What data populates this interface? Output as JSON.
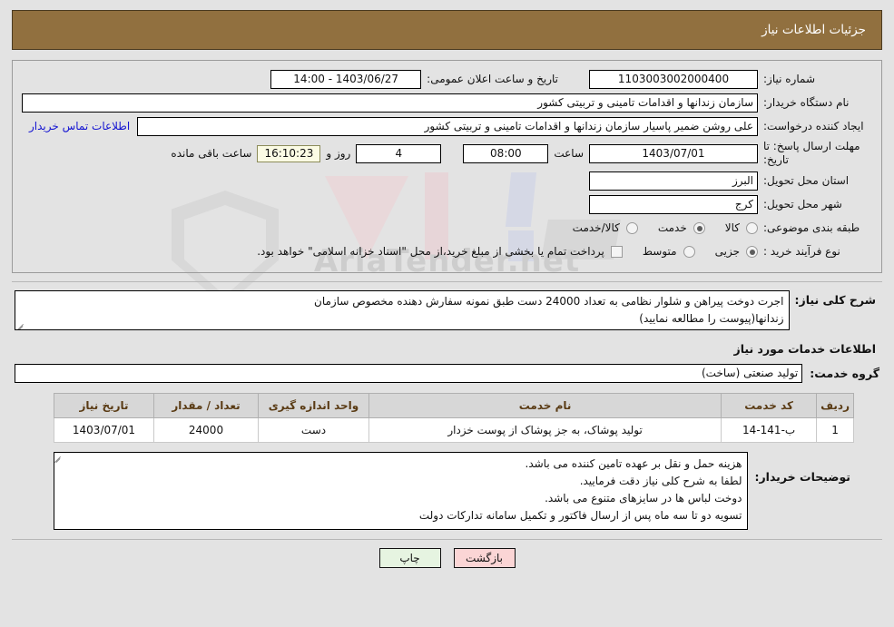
{
  "header": {
    "title": "جزئیات اطلاعات نیاز"
  },
  "form": {
    "need_number_label": "شماره نیاز:",
    "need_number_value": "1103003002000400",
    "public_announce_label": "تاریخ و ساعت اعلان عمومی:",
    "public_announce_value": "1403/06/27 - 14:00",
    "buyer_org_label": "نام دستگاه خریدار:",
    "buyer_org_value": "سازمان زندانها و اقدامات تامینی و تربیتی کشور",
    "requester_label": "ایجاد کننده درخواست:",
    "requester_value": "علی روشن ضمیر پاسیار سازمان زندانها و اقدامات تامینی و تربیتی کشور",
    "contact_link": "اطلاعات تماس خریدار",
    "deadline_label": "مهلت ارسال پاسخ: تا تاریخ:",
    "deadline_date": "1403/07/01",
    "deadline_time_label": "ساعت",
    "deadline_time": "08:00",
    "remaining_days": "4",
    "remaining_days_label": "روز و",
    "remaining_clock": "16:10:23",
    "remaining_suffix_label": "ساعت باقی مانده",
    "province_label": "استان محل تحویل:",
    "province_value": "البرز",
    "city_label": "شهر محل تحویل:",
    "city_value": "کرج",
    "category_label": "طبقه بندی موضوعی:",
    "category_options": [
      {
        "label": "کالا",
        "selected": false
      },
      {
        "label": "خدمت",
        "selected": true
      },
      {
        "label": "کالا/خدمت",
        "selected": false
      }
    ],
    "purchase_type_label": "نوع فرآیند خرید :",
    "purchase_type_options": [
      {
        "label": "جزیی",
        "selected": true
      },
      {
        "label": "متوسط",
        "selected": false
      }
    ],
    "treasury_checkbox_label": "پرداخت تمام یا بخشی از مبلغ خرید،از محل \"اسناد خزانه اسلامی\" خواهد بود.",
    "treasury_checked": false
  },
  "description": {
    "label": "شرح کلی نیاز:",
    "lines": [
      "اجرت دوخت پیراهن و شلوار نظامی به تعداد 24000 دست طبق نمونه سفارش دهنده مخصوص سازمان",
      "زندانها(پیوست را مطالعه نمایید)"
    ]
  },
  "services_section": {
    "heading": "اطلاعات خدمات مورد نیاز",
    "group_label": "گروه خدمت:",
    "group_value": "تولید صنعتی (ساخت)"
  },
  "table": {
    "columns": [
      "ردیف",
      "کد خدمت",
      "نام خدمت",
      "واحد اندازه گیری",
      "تعداد / مقدار",
      "تاریخ نیاز"
    ],
    "rows": [
      {
        "radif": "1",
        "code": "ب-141-14",
        "name": "تولید پوشاک، به جز پوشاک از پوست خزدار",
        "unit": "دست",
        "quantity": "24000",
        "date": "1403/07/01"
      }
    ]
  },
  "buyer_notes": {
    "label": "توضیحات خریدار:",
    "lines": [
      "هزینه حمل و نقل بر عهده تامین کننده می باشد.",
      "لطفا به شرح کلی نیاز دقت فرمایید.",
      "دوخت لباس ها در سایزهای متنوع می باشد.",
      "تسویه دو تا سه ماه پس از ارسال فاکتور و تکمیل سامانه تدارکات دولت"
    ]
  },
  "footer": {
    "back_label": "بازگشت",
    "print_label": "چاپ"
  },
  "watermark": {
    "text": "AriaTender.net"
  },
  "colors": {
    "header_bg": "#91703f",
    "link": "#1414d2",
    "table_header_bg": "#d7d7d7",
    "table_header_text": "#5a3b14",
    "back_button_bg": "#fbd5d5",
    "print_button_bg": "#e6f4e1",
    "clock_bg": "#fbfbe4"
  }
}
